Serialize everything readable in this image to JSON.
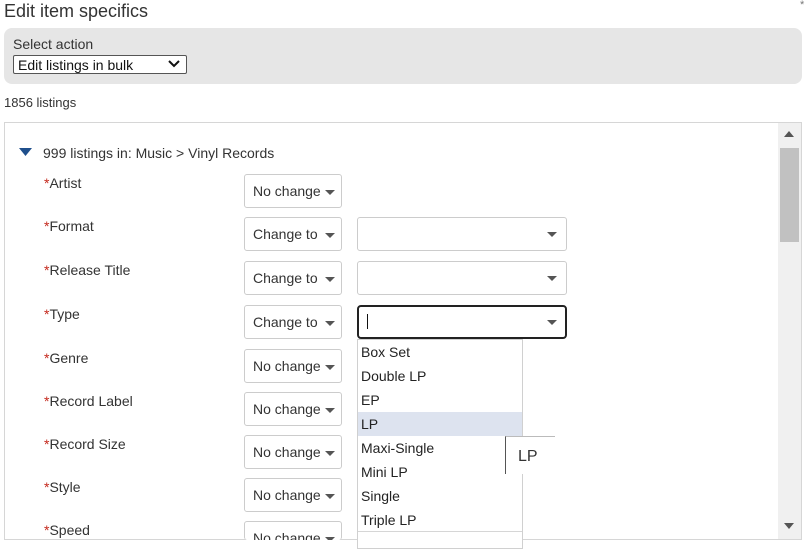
{
  "window": {
    "title": "Edit item specifics",
    "corner_mark": "*"
  },
  "action": {
    "label": "Select action",
    "selected": "Edit listings in bulk"
  },
  "listings_count": "1856 listings",
  "group": {
    "title": "999 listings in: Music > Vinyl Records"
  },
  "rows": [
    {
      "label": "Artist",
      "action": "No change"
    },
    {
      "label": "Format",
      "action": "Change to",
      "value": ""
    },
    {
      "label": "Release Title",
      "action": "Change to",
      "value": ""
    },
    {
      "label": "Type",
      "action": "Change to",
      "value": ""
    },
    {
      "label": "Genre",
      "action": "No change"
    },
    {
      "label": "Record Label",
      "action": "No change"
    },
    {
      "label": "Record Size",
      "action": "No change"
    },
    {
      "label": "Style",
      "action": "No change"
    },
    {
      "label": "Speed",
      "action": "No change"
    }
  ],
  "required_marker": "*",
  "type_dropdown": {
    "options": [
      "Box Set",
      "Double LP",
      "EP",
      "LP",
      "Maxi-Single",
      "Mini LP",
      "Single",
      "Triple LP"
    ],
    "highlighted": "LP"
  },
  "tooltip": {
    "text": "LP"
  },
  "icons": {
    "group_toggle": "caret-down-icon",
    "select_arrow": "chevron-down-icon",
    "dropdown_arrow": "triangle-down-icon",
    "scroll_up": "scroll-up-arrow-icon",
    "scroll_down": "scroll-down-arrow-icon"
  },
  "colors": {
    "required": "#c4281c",
    "accent_caret": "#1f4f8c",
    "panel_bg": "#e6e6e6",
    "highlight": "#dde3ef"
  }
}
